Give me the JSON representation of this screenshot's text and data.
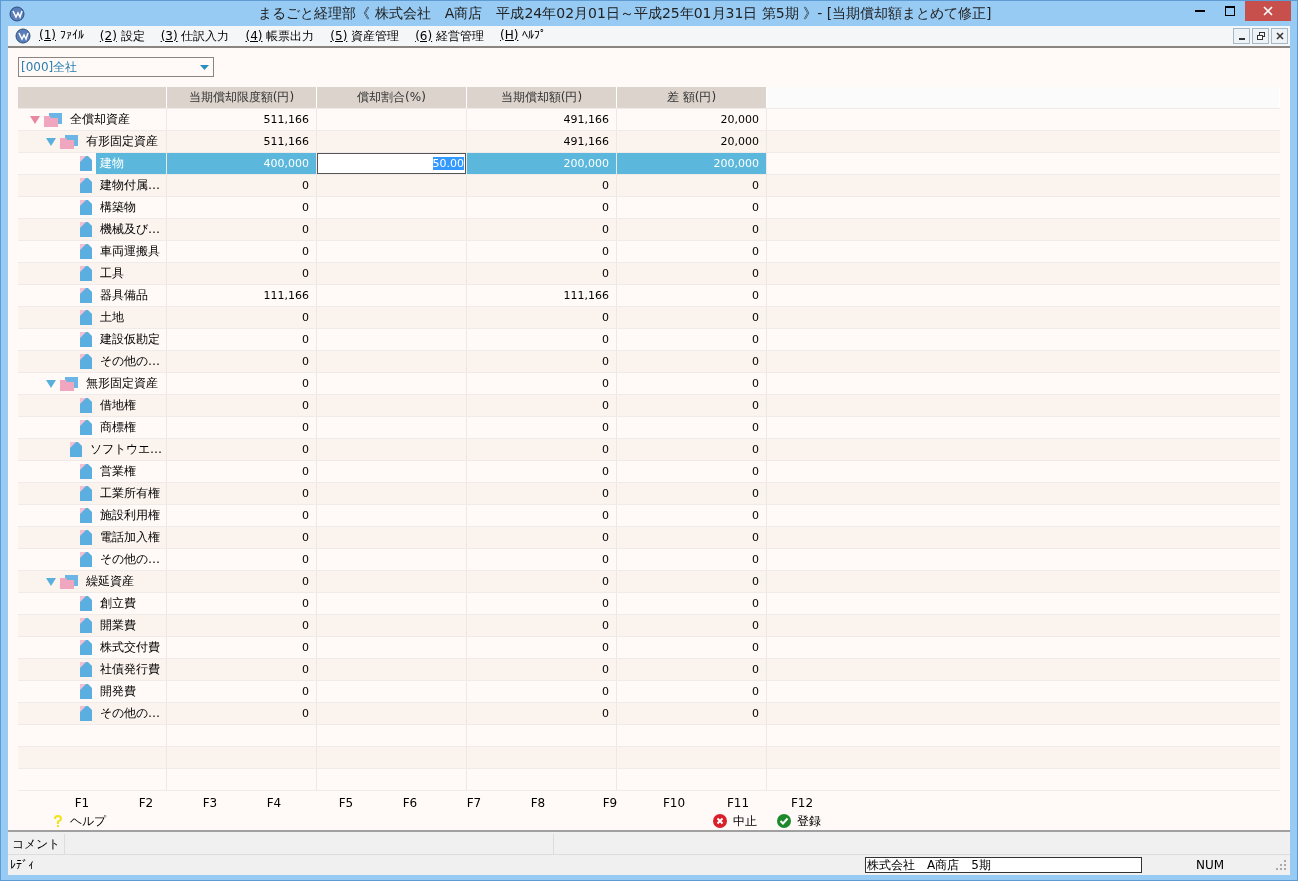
{
  "window": {
    "title": "まるごと経理部《 株式会社　A商店　平成24年02月01日～平成25年01月31日 第5期 》- [当期償却額まとめて修正]"
  },
  "menu": [
    {
      "mnemonic": "(1)",
      "label": "ﾌｧｲﾙ"
    },
    {
      "mnemonic": "(2)",
      "label": "設定"
    },
    {
      "mnemonic": "(3)",
      "label": "仕訳入力"
    },
    {
      "mnemonic": "(4)",
      "label": "帳票出力"
    },
    {
      "mnemonic": "(5)",
      "label": "資産管理"
    },
    {
      "mnemonic": "(6)",
      "label": "経営管理"
    },
    {
      "mnemonic": "(H)",
      "label": "ﾍﾙﾌﾟ"
    }
  ],
  "department": {
    "value": "[000]全社"
  },
  "table": {
    "columns": [
      "当期償却限度額(円)",
      "償却割合(%)",
      "当期償却額(円)",
      "差 額(円)"
    ],
    "rows": [
      {
        "name": "全償却資産",
        "expanded": true,
        "selected": false,
        "limit": "511,166",
        "amount": "491,166",
        "diff": "20,000",
        "children": [
          {
            "name": "有形固定資産",
            "expanded": true,
            "selected": false,
            "limit": "511,166",
            "amount": "491,166",
            "diff": "20,000",
            "children": [
              {
                "name": "建物",
                "selected": true,
                "limit": "400,000",
                "rate": "50.00",
                "amount": "200,000",
                "diff": "200,000"
              },
              {
                "name": "建物付属…",
                "selected": false,
                "limit": "0",
                "amount": "0",
                "diff": "0"
              },
              {
                "name": "構築物",
                "selected": false,
                "limit": "0",
                "amount": "0",
                "diff": "0"
              },
              {
                "name": "機械及び…",
                "selected": false,
                "limit": "0",
                "amount": "0",
                "diff": "0"
              },
              {
                "name": "車両運搬具",
                "selected": false,
                "limit": "0",
                "amount": "0",
                "diff": "0"
              },
              {
                "name": "工具",
                "selected": false,
                "limit": "0",
                "amount": "0",
                "diff": "0"
              },
              {
                "name": "器具備品",
                "selected": false,
                "limit": "111,166",
                "amount": "111,166",
                "diff": "0"
              },
              {
                "name": "土地",
                "selected": false,
                "limit": "0",
                "amount": "0",
                "diff": "0"
              },
              {
                "name": "建設仮勘定",
                "selected": false,
                "limit": "0",
                "amount": "0",
                "diff": "0"
              },
              {
                "name": "その他の…",
                "selected": false,
                "limit": "0",
                "amount": "0",
                "diff": "0"
              }
            ]
          },
          {
            "name": "無形固定資産",
            "expanded": true,
            "selected": false,
            "limit": "0",
            "amount": "0",
            "diff": "0",
            "children": [
              {
                "name": "借地権",
                "selected": false,
                "limit": "0",
                "amount": "0",
                "diff": "0"
              },
              {
                "name": "商標権",
                "selected": false,
                "limit": "0",
                "amount": "0",
                "diff": "0"
              },
              {
                "name": "ソフトウエ…",
                "selected": false,
                "limit": "0",
                "amount": "0",
                "diff": "0"
              },
              {
                "name": "営業権",
                "selected": false,
                "limit": "0",
                "amount": "0",
                "diff": "0"
              },
              {
                "name": "工業所有権",
                "selected": false,
                "limit": "0",
                "amount": "0",
                "diff": "0"
              },
              {
                "name": "施設利用権",
                "selected": false,
                "limit": "0",
                "amount": "0",
                "diff": "0"
              },
              {
                "name": "電話加入権",
                "selected": false,
                "limit": "0",
                "amount": "0",
                "diff": "0"
              },
              {
                "name": "その他の…",
                "selected": false,
                "limit": "0",
                "amount": "0",
                "diff": "0"
              }
            ]
          },
          {
            "name": "繰延資産",
            "expanded": true,
            "selected": false,
            "limit": "0",
            "amount": "0",
            "diff": "0",
            "children": [
              {
                "name": "創立費",
                "selected": false,
                "limit": "0",
                "amount": "0",
                "diff": "0"
              },
              {
                "name": "開業費",
                "selected": false,
                "limit": "0",
                "amount": "0",
                "diff": "0"
              },
              {
                "name": "株式交付費",
                "selected": false,
                "limit": "0",
                "amount": "0",
                "diff": "0"
              },
              {
                "name": "社債発行費",
                "selected": false,
                "limit": "0",
                "amount": "0",
                "diff": "0"
              },
              {
                "name": "開発費",
                "selected": false,
                "limit": "0",
                "amount": "0",
                "diff": "0"
              },
              {
                "name": "その他の…",
                "selected": false,
                "limit": "0",
                "amount": "0",
                "diff": "0"
              }
            ]
          }
        ]
      }
    ]
  },
  "function_keys": [
    {
      "key": "F1",
      "action": "ヘルプ",
      "kind": "help"
    },
    {
      "key": "F2"
    },
    {
      "key": "F3"
    },
    {
      "key": "F4"
    },
    {
      "key": "F5"
    },
    {
      "key": "F6"
    },
    {
      "key": "F7"
    },
    {
      "key": "F8"
    },
    {
      "key": "F9"
    },
    {
      "key": "F10"
    },
    {
      "key": "F11",
      "action": "中止",
      "kind": "cancel"
    },
    {
      "key": "F12",
      "action": "登録",
      "kind": "ok"
    }
  ],
  "comment_bar": {
    "label": "コメント"
  },
  "status_bar": {
    "status": "ﾚﾃﾞｨ",
    "company": "株式会社　A商店　5期",
    "num": "NUM"
  }
}
